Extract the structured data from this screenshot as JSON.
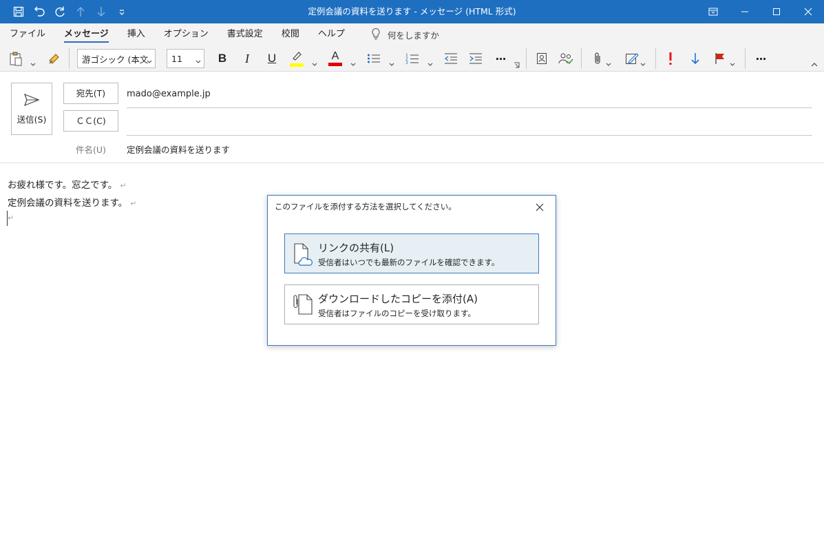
{
  "window": {
    "title": "定例会議の資料を送ります  -  メッセージ (HTML 形式)"
  },
  "menu": {
    "tabs": [
      "ファイル",
      "メッセージ",
      "挿入",
      "オプション",
      "書式設定",
      "校閲",
      "ヘルプ"
    ],
    "active_tab": "メッセージ",
    "tell_me": "何をしますか"
  },
  "ribbon": {
    "font_name": "游ゴシック (本文の",
    "font_size": "11",
    "bold": "B",
    "italic": "I",
    "underline": "U",
    "highlight_color": "#ffff00",
    "font_color_letter": "A",
    "font_color": "#e00000",
    "more": "···"
  },
  "compose": {
    "send_label": "送信(S)",
    "to_button": "宛先(T)",
    "cc_button": "ＣＣ(C)",
    "to_value": "mado@example.jp",
    "cc_value": "",
    "subject_label": "件名(U)",
    "subject_value": "定例会議の資料を送ります"
  },
  "body": {
    "lines": [
      "お疲れ様です。窓之です。",
      "定例会議の資料を送ります。",
      ""
    ],
    "return_mark": "↵"
  },
  "dialog": {
    "title": "このファイルを添付する方法を選択してください。",
    "options": [
      {
        "title": "リンクの共有(L)",
        "desc": "受信者はいつでも最新のファイルを確認できます。",
        "selected": true
      },
      {
        "title": "ダウンロードしたコピーを添付(A)",
        "desc": "受信者はファイルのコピーを受け取ります。",
        "selected": false
      }
    ]
  },
  "colors": {
    "titlebar": "#1e6fc0",
    "accent": "#2b6cbf",
    "flag_red": "#c42b1c",
    "importance_red": "#e81123",
    "low_importance_blue": "#1e73d2"
  }
}
